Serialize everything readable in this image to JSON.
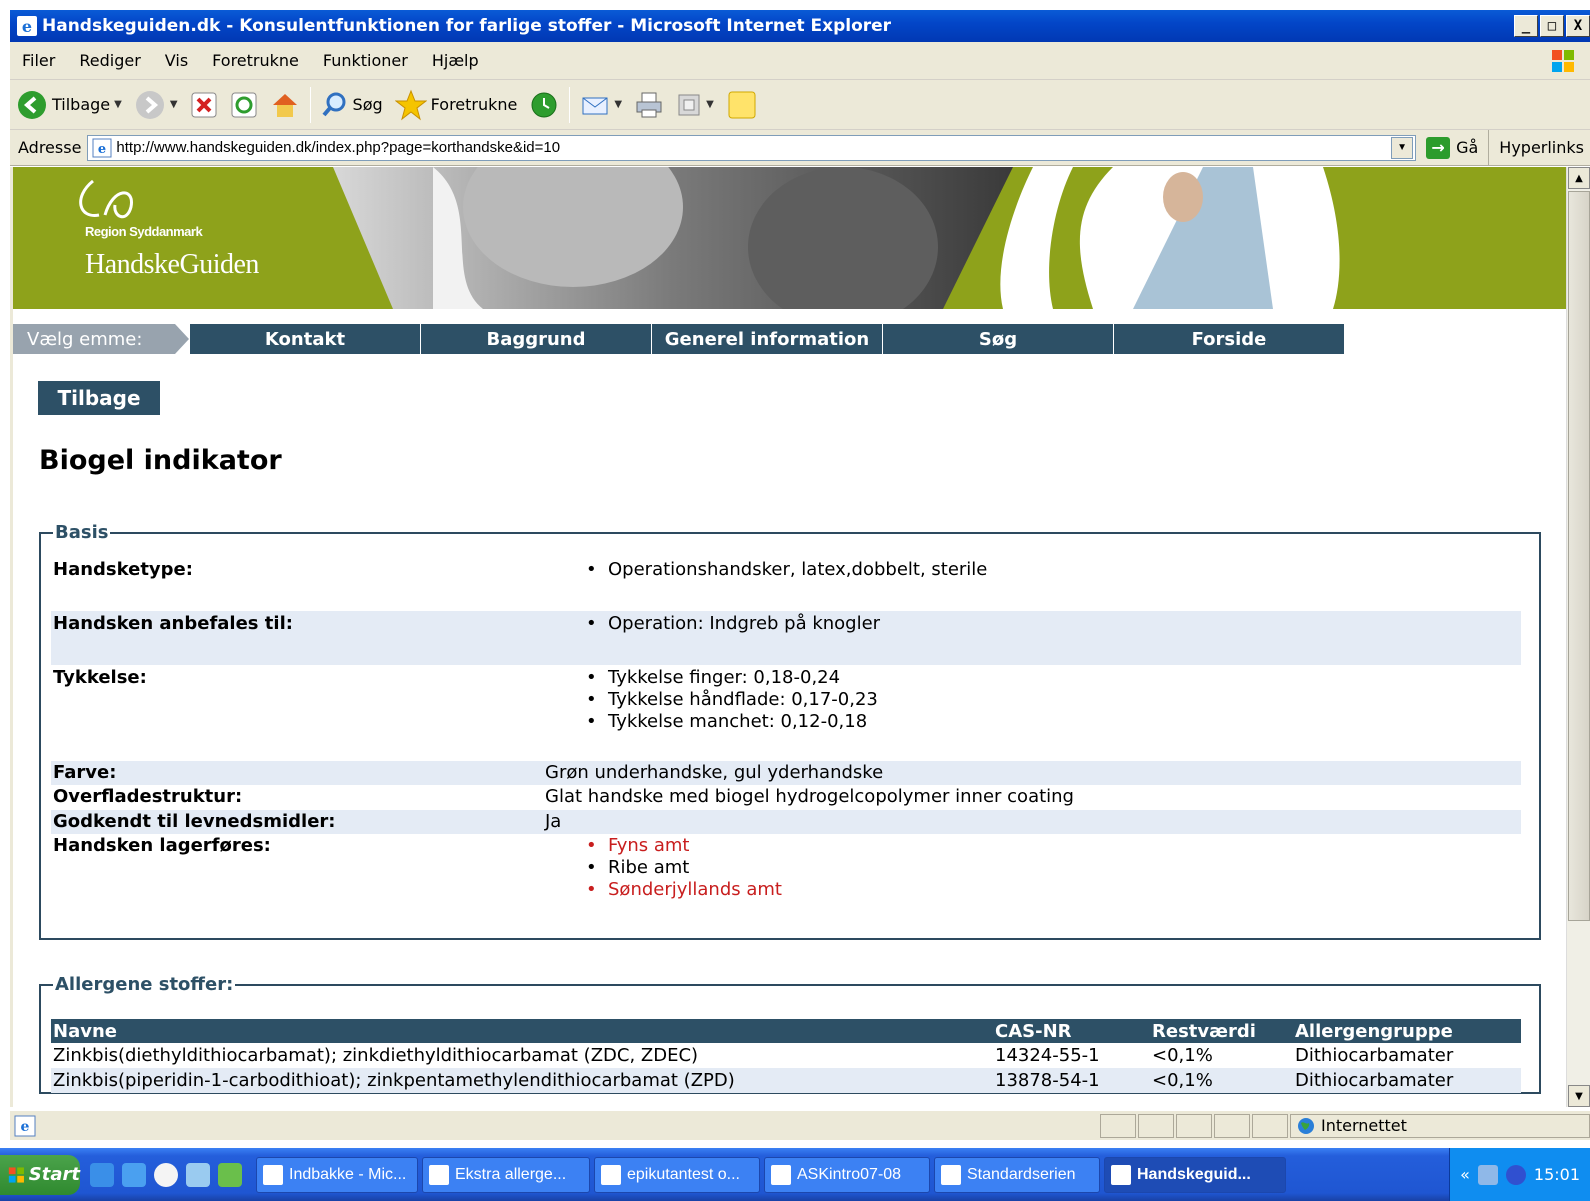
{
  "window": {
    "title": "Handskeguiden.dk - Konsulentfunktionen for farlige stoffer - Microsoft Internet Explorer",
    "min": "_",
    "max": "□",
    "close": "X"
  },
  "menubar": {
    "items": [
      "Filer",
      "Rediger",
      "Vis",
      "Foretrukne",
      "Funktioner",
      "Hjælp"
    ]
  },
  "toolbar": {
    "back_label": "Tilbage",
    "search_label": "Søg",
    "favorites_label": "Foretrukne"
  },
  "addressbar": {
    "label": "Adresse",
    "url": "http://www.handskeguiden.dk/index.php?page=korthandske&id=10",
    "go_label": "Gå",
    "links_label": "Hyperlinks"
  },
  "banner": {
    "org": "Region Syddanmark",
    "site": "HandskeGuiden",
    "brand_color": "#8ea21b"
  },
  "nav": {
    "label": "Vælg emme:",
    "items": [
      "Kontakt",
      "Baggrund",
      "Generel information",
      "Søg",
      "Forside"
    ],
    "accent": "#2d5066"
  },
  "back_button": "Tilbage",
  "product": {
    "title": "Biogel indikator",
    "basis_legend": "Basis",
    "handsketype_label": "Handsketype:",
    "handsketype": [
      "Operationshandsker, latex,dobbelt, sterile"
    ],
    "anbefales_label": "Handsken anbefales til:",
    "anbefales": [
      "Operation: Indgreb på knogler"
    ],
    "tykkelse_label": "Tykkelse:",
    "tykkelse": [
      "Tykkelse finger: 0,18-0,24",
      "Tykkelse håndflade: 0,17-0,23",
      "Tykkelse manchet: 0,12-0,18"
    ],
    "farve_label": "Farve:",
    "farve": "Grøn underhandske, gul yderhandske",
    "overflade_label": "Overfladestruktur:",
    "overflade": "Glat handske med biogel hydrogelcopolymer inner coating",
    "godkendt_label": "Godkendt til levnedsmidler:",
    "godkendt": "Ja",
    "lager_label": "Handsken lagerføres:",
    "lager": [
      "Fyns amt",
      "Ribe amt",
      "Sønderjyllands amt"
    ]
  },
  "allergens": {
    "legend": "Allergene stoffer:",
    "headers": [
      "Navne",
      "CAS-NR",
      "Restværdi",
      "Allergengruppe"
    ],
    "rows": [
      [
        "Zinkbis(diethyldithiocarbamat); zinkdiethyldithiocarbamat (ZDC, ZDEC)",
        "14324-55-1",
        "<0,1%",
        "Dithiocarbamater"
      ],
      [
        "Zinkbis(piperidin-1-carbodithioat); zinkpentamethylendithiocarbamat (ZPD)",
        "13878-54-1",
        "<0,1%",
        "Dithiocarbamater"
      ]
    ]
  },
  "statusbar": {
    "zone": "Internettet"
  },
  "taskbar": {
    "start": "Start",
    "tasks": [
      "Indbakke - Mic...",
      "Ekstra allerge...",
      "epikutantest o...",
      "ASKintro07-08",
      "Standardserien",
      "Handskeguid..."
    ],
    "clock": "15:01",
    "chevron": "«"
  }
}
